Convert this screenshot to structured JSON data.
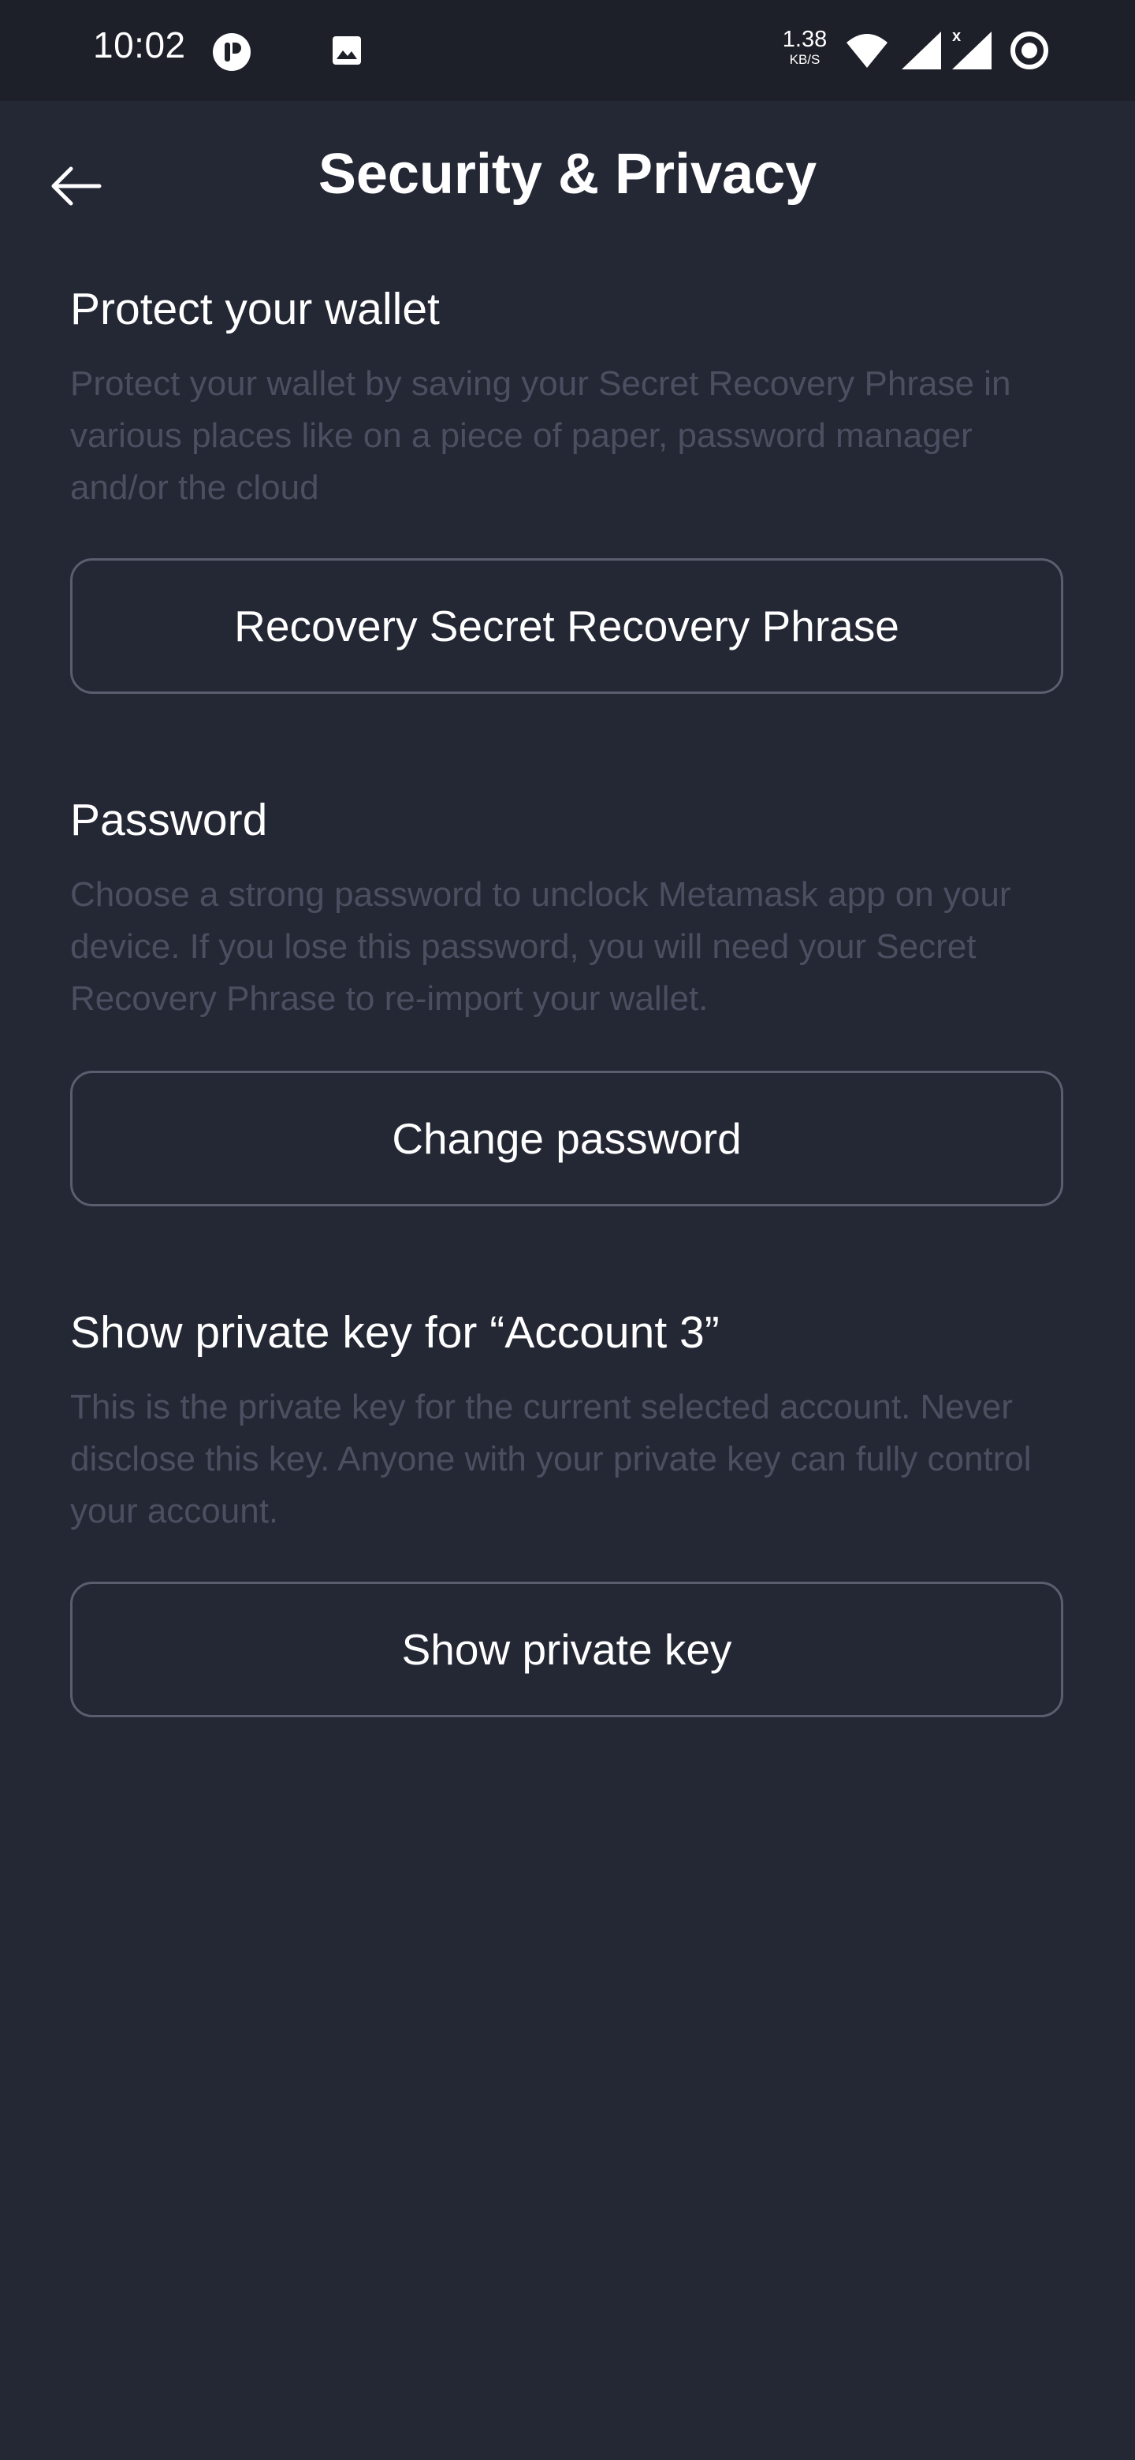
{
  "status_bar": {
    "time": "10:02",
    "net_speed_value": "1.38",
    "net_speed_unit": "KB/S",
    "icons": [
      "app-notification-icon",
      "image-notification-icon",
      "wifi-icon",
      "signal-no-data-icon",
      "signal-icon",
      "record-icon"
    ]
  },
  "header": {
    "title": "Security & Privacy",
    "back_icon": "arrow-left-icon"
  },
  "sections": [
    {
      "title": "Protect your wallet",
      "description": "Protect your wallet by saving your Secret Recovery Phrase in various places like on a piece of paper, password manager and/or the cloud",
      "button_label": "Recovery Secret Recovery Phrase"
    },
    {
      "title": "Password",
      "description": "Choose a strong password to unclock Metamask app on your device. If you lose this password, you will need your Secret Recovery Phrase to re-import your wallet.",
      "button_label": "Change password"
    },
    {
      "title": "Show private key for “Account 3”",
      "description": "This is the private key for the current selected account. Never disclose this key. Anyone with your private key can fully control your account.",
      "button_label": "Show private key"
    }
  ],
  "colors": {
    "background": "#242734",
    "status_bar": "#1d1f29",
    "text_primary": "#ffffff",
    "text_muted": "#4b4f60",
    "button_border": "#5a5e6e"
  }
}
